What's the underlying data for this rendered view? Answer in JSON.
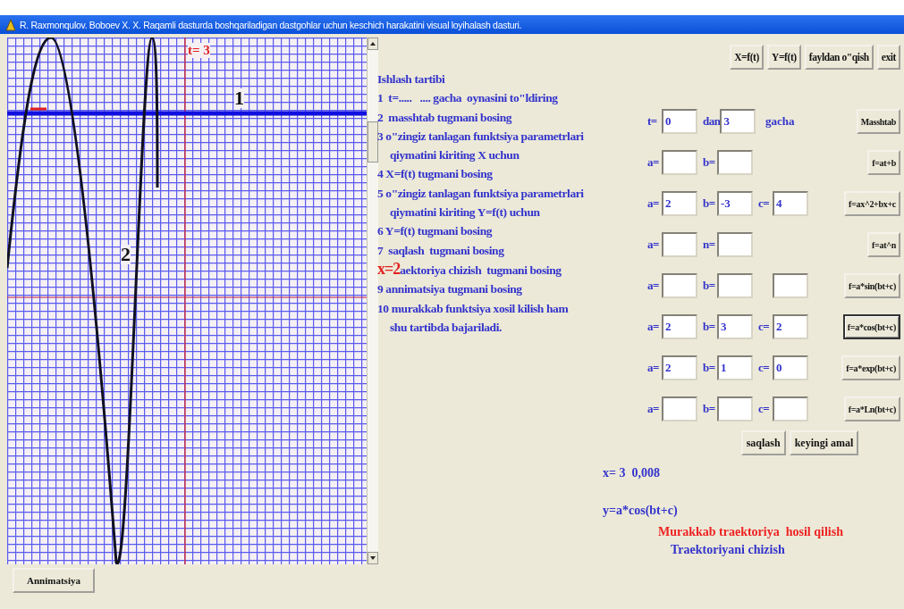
{
  "window": {
    "title": "R. Raxmonqulov. Boboev  X. X.  Raqamli dasturda boshqariladigan dastgohlar uchun keschich harakatini visual loyihalash dasturi."
  },
  "plot": {
    "t_label": "t= 3",
    "curve_labels": [
      "1",
      "2"
    ]
  },
  "animation_button": "Annimatsiya",
  "instructions": {
    "heading": "Ishlash tartibi",
    "lines": [
      {
        "kind": "step",
        "text": "1  t=.....   .... gacha  oynasini to\"ldiring"
      },
      {
        "kind": "step",
        "text": "2  masshtab tugmani bosing"
      },
      {
        "kind": "step",
        "text": "3 o\"zingiz tanlagan funktsiya parametrlari"
      },
      {
        "kind": "continuation",
        "text": "qiymatini kiriting X uchun"
      },
      {
        "kind": "step",
        "text": "4 X=f(t) tugmani bosing"
      },
      {
        "kind": "step",
        "text": "5 o\"zingiz tanlagan funktsiya parametrlari"
      },
      {
        "kind": "continuation",
        "text": "qiymatini kiriting Y=f(t) uchun"
      },
      {
        "kind": "step",
        "text": "6 Y=f(t) tugmani bosing"
      },
      {
        "kind": "step",
        "text": "7  saqlash  tugmani bosing"
      },
      {
        "kind": "marked",
        "marker": "x=2",
        "text": "aektoriya chizish  tugmani bosing"
      },
      {
        "kind": "step",
        "text": "9 annimatsiya tugmani bosing"
      },
      {
        "kind": "step",
        "text": "10 murakkab funktsiya xosil kilish ham"
      },
      {
        "kind": "continuation",
        "text": "shu tartibda bajariladi."
      }
    ]
  },
  "toolbar": [
    "X=f(t)",
    "Y=f(t)",
    "fayldan o\"qish",
    "exit"
  ],
  "rows": [
    {
      "fields": [
        {
          "kind": "labeled",
          "label": "t=",
          "value": "0"
        },
        {
          "kind": "labeled",
          "label": "dan",
          "value": "3"
        }
      ],
      "suffix": "gacha",
      "button": {
        "label": "Masshtab",
        "selected": false
      }
    },
    {
      "fields": [
        {
          "kind": "labeled",
          "label": "a="
        },
        {
          "kind": "labeled",
          "label": "b="
        }
      ],
      "button": {
        "label": "f=at+b",
        "selected": false
      }
    },
    {
      "fields": [
        {
          "kind": "labeled",
          "label": "a=",
          "value": "2"
        },
        {
          "kind": "labeled",
          "label": "b=",
          "value": "-3"
        },
        {
          "kind": "labeled",
          "label": "c=",
          "value": "4"
        }
      ],
      "button": {
        "label": "f=ax^2+bx+c",
        "selected": false
      }
    },
    {
      "fields": [
        {
          "kind": "labeled",
          "label": "a="
        },
        {
          "kind": "labeled",
          "label": "n="
        }
      ],
      "button": {
        "label": "f=at^n",
        "selected": false
      }
    },
    {
      "fields": [
        {
          "kind": "labeled",
          "label": "a="
        },
        {
          "kind": "labeled",
          "label": "b="
        },
        {
          "kind": "bare"
        }
      ],
      "button": {
        "label": "f=a*sin(bt+c)",
        "selected": false
      }
    },
    {
      "fields": [
        {
          "kind": "labeled",
          "label": "a=",
          "value": "2"
        },
        {
          "kind": "labeled",
          "label": "b=",
          "value": "3"
        },
        {
          "kind": "labeled",
          "label": "c=",
          "value": "2"
        }
      ],
      "button": {
        "label": "f=a*cos(bt+c)",
        "selected": true
      }
    },
    {
      "fields": [
        {
          "kind": "labeled",
          "label": "a=",
          "value": "2"
        },
        {
          "kind": "labeled",
          "label": "b=",
          "value": "1"
        },
        {
          "kind": "labeled",
          "label": "c=",
          "value": "0"
        }
      ],
      "button": {
        "label": "f=a*exp(bt+c)",
        "selected": false
      }
    },
    {
      "fields": [
        {
          "kind": "labeled",
          "label": "a="
        },
        {
          "kind": "labeled",
          "label": "b="
        },
        {
          "kind": "labeled",
          "label": "c="
        }
      ],
      "button": {
        "label": "f=a*Ln(bt+c)",
        "selected": false
      }
    }
  ],
  "actions": [
    "saqlash",
    "keyingi amal"
  ],
  "result": {
    "x_value": "x= 3  0,008",
    "formula": "y=a*cos(bt+c)"
  },
  "links": [
    {
      "text": "Murakkab traektoriya  hosil qilish",
      "color": "#ee2222"
    },
    {
      "text": "Traektoriyani chizish",
      "color": "#3333cc"
    }
  ]
}
